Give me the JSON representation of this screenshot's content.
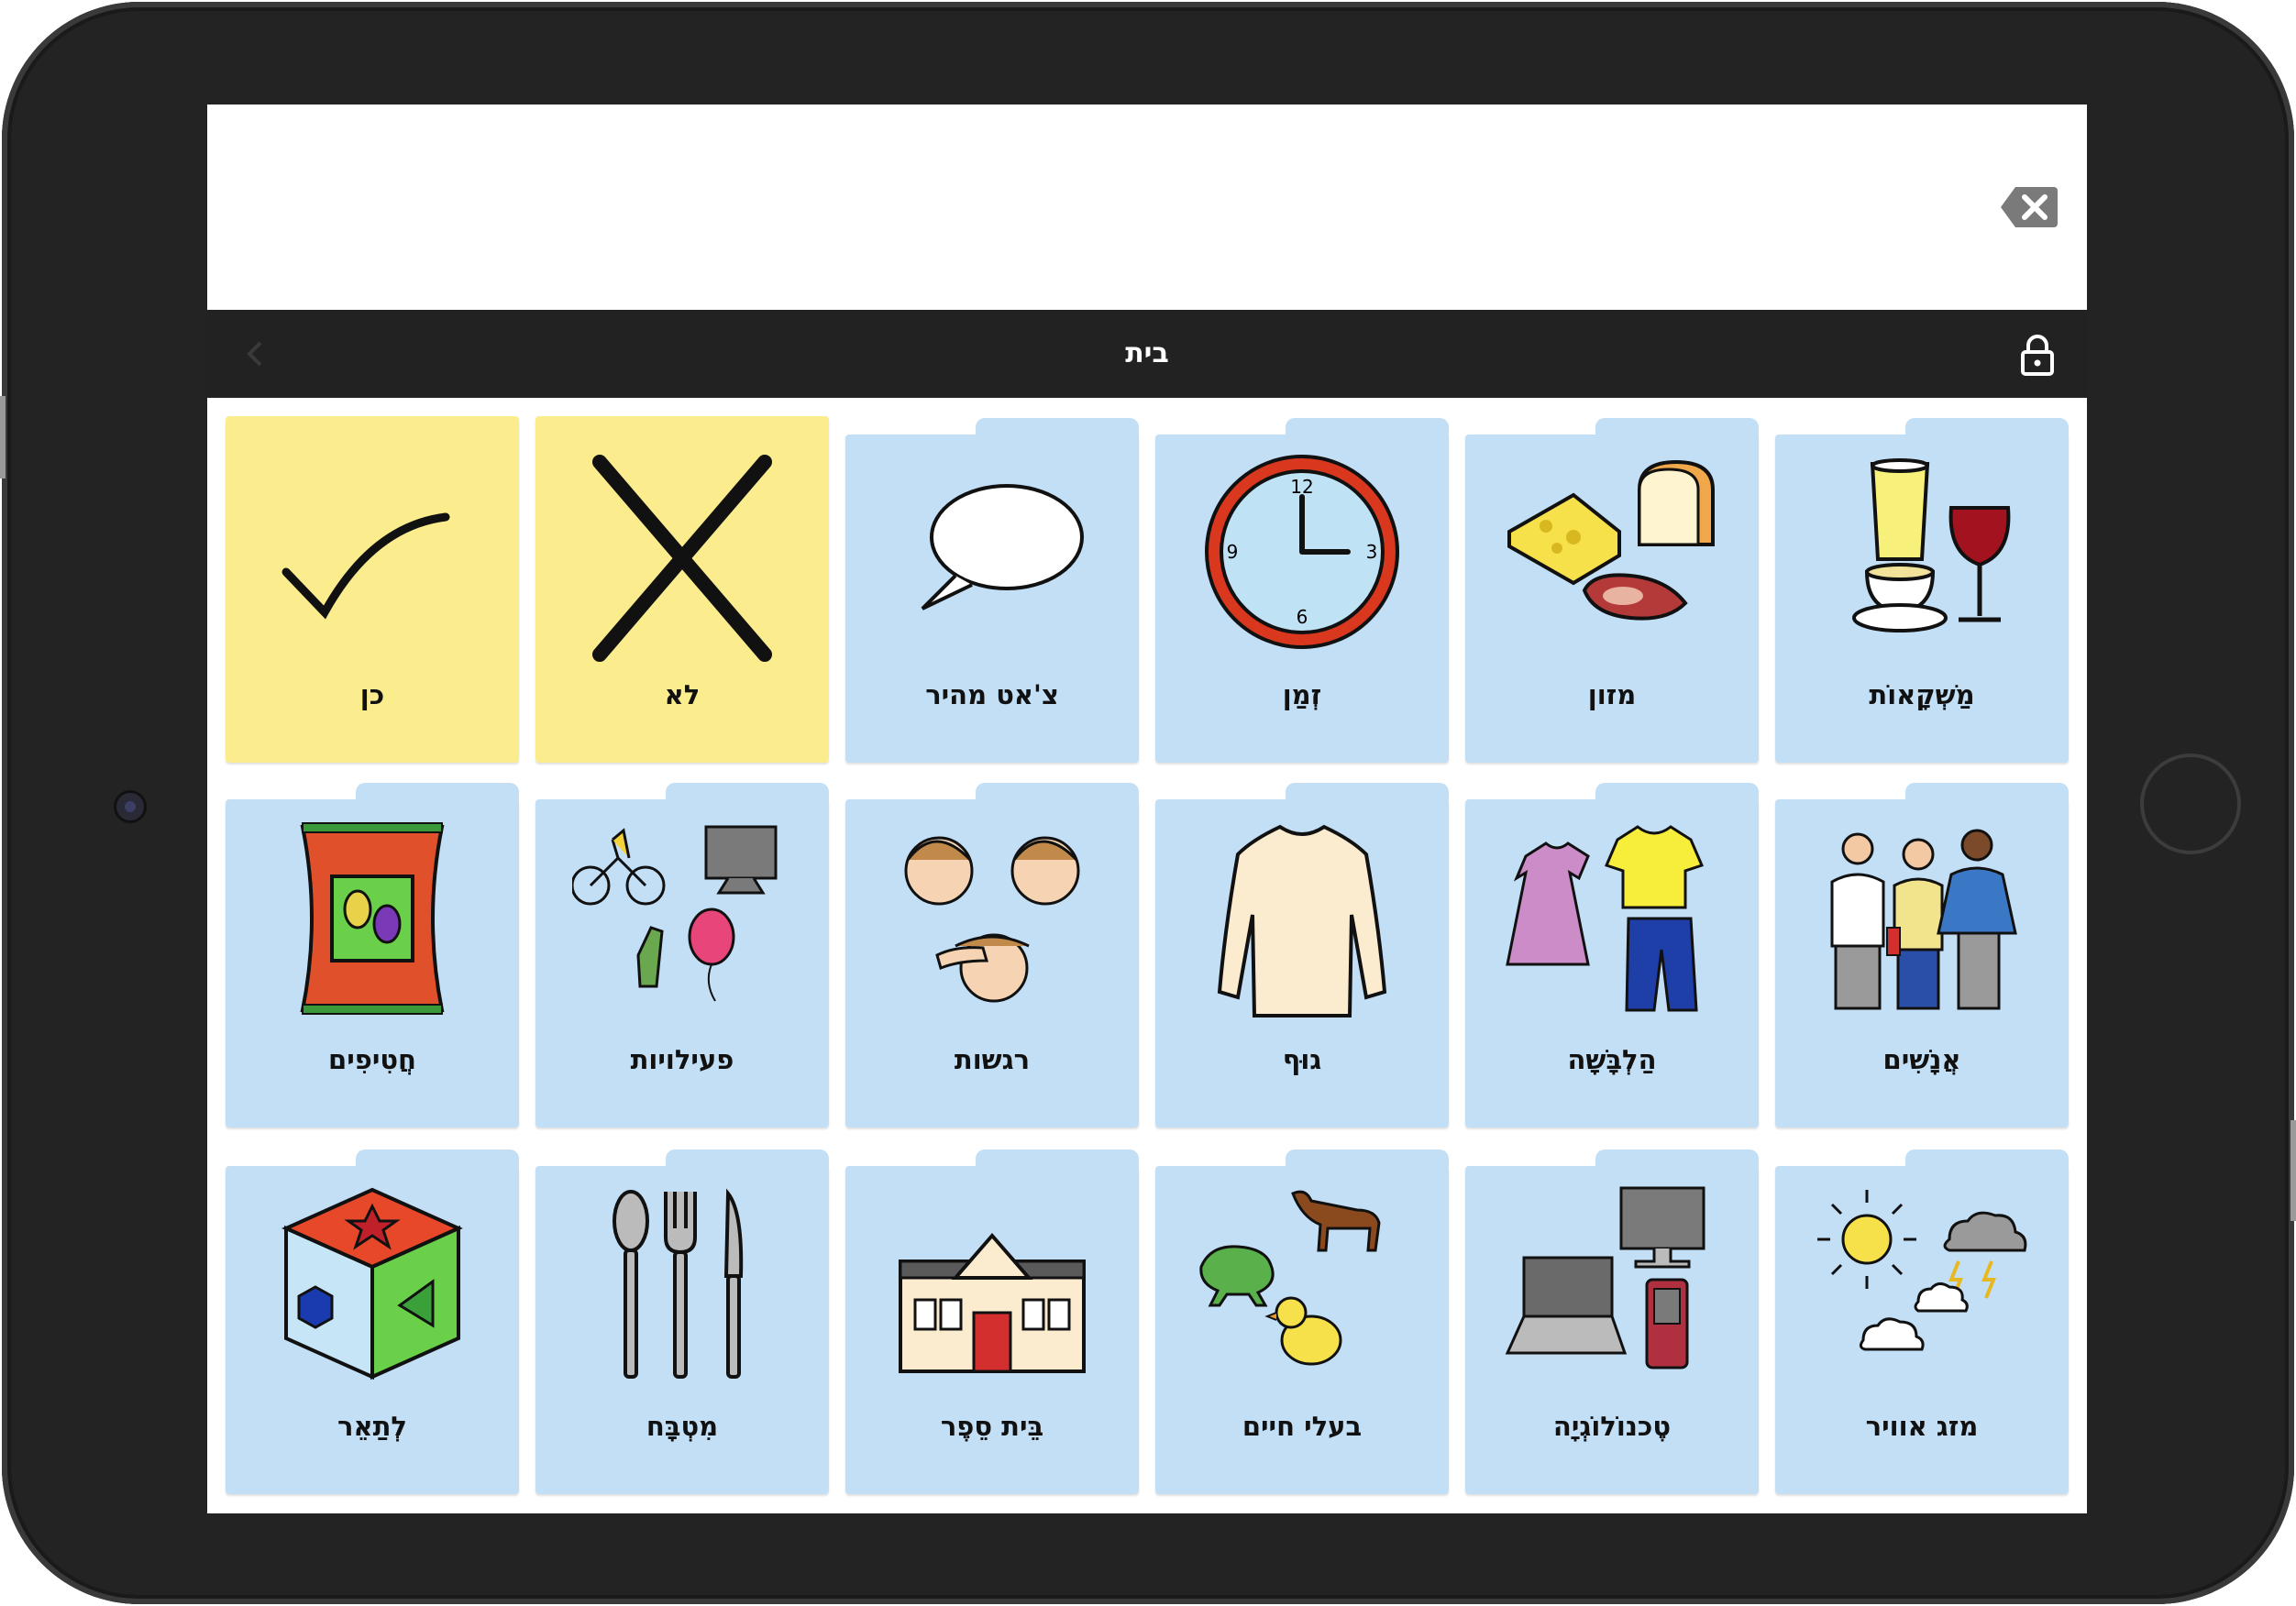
{
  "header": {
    "title": "בית",
    "backspace_icon": "backspace-icon",
    "lock_icon": "lock-icon",
    "back_icon": "back-arrow-icon"
  },
  "message_bar": {
    "text": ""
  },
  "colors": {
    "device": "#232323",
    "title_bar": "#222222",
    "folder_tile": "#c3dff6",
    "word_tile": "#fbed8d"
  },
  "tiles": [
    {
      "label": "מַשְׁקָאוֹת",
      "type": "folder",
      "icon": "drinks-icon"
    },
    {
      "label": "מזון",
      "type": "folder",
      "icon": "food-icon"
    },
    {
      "label": "זְמַן",
      "type": "folder",
      "icon": "clock-icon"
    },
    {
      "label": "צ'אט מהיר",
      "type": "folder",
      "icon": "speech-bubble-icon"
    },
    {
      "label": "לא",
      "type": "word",
      "icon": "cross-icon"
    },
    {
      "label": "כן",
      "type": "word",
      "icon": "checkmark-icon"
    },
    {
      "label": "אֲנָשִׁים",
      "type": "folder",
      "icon": "people-icon"
    },
    {
      "label": "הַלְבָּשָׁה",
      "type": "folder",
      "icon": "clothes-icon"
    },
    {
      "label": "גוּף",
      "type": "folder",
      "icon": "body-icon"
    },
    {
      "label": "רגשות",
      "type": "folder",
      "icon": "feelings-icon"
    },
    {
      "label": "פעילויות",
      "type": "folder",
      "icon": "activities-icon"
    },
    {
      "label": "חֲטִיפִים",
      "type": "folder",
      "icon": "snacks-icon"
    },
    {
      "label": "מזג אוויר",
      "type": "folder",
      "icon": "weather-icon"
    },
    {
      "label": "טֶכנוֹלוֹגְיָה",
      "type": "folder",
      "icon": "technology-icon"
    },
    {
      "label": "בעלי חיים",
      "type": "folder",
      "icon": "animals-icon"
    },
    {
      "label": "בֵּית סֵפֶר",
      "type": "folder",
      "icon": "school-icon"
    },
    {
      "label": "מִטְבָּח",
      "type": "folder",
      "icon": "kitchen-icon"
    },
    {
      "label": "לְתַאֵר",
      "type": "folder",
      "icon": "describe-icon"
    }
  ]
}
